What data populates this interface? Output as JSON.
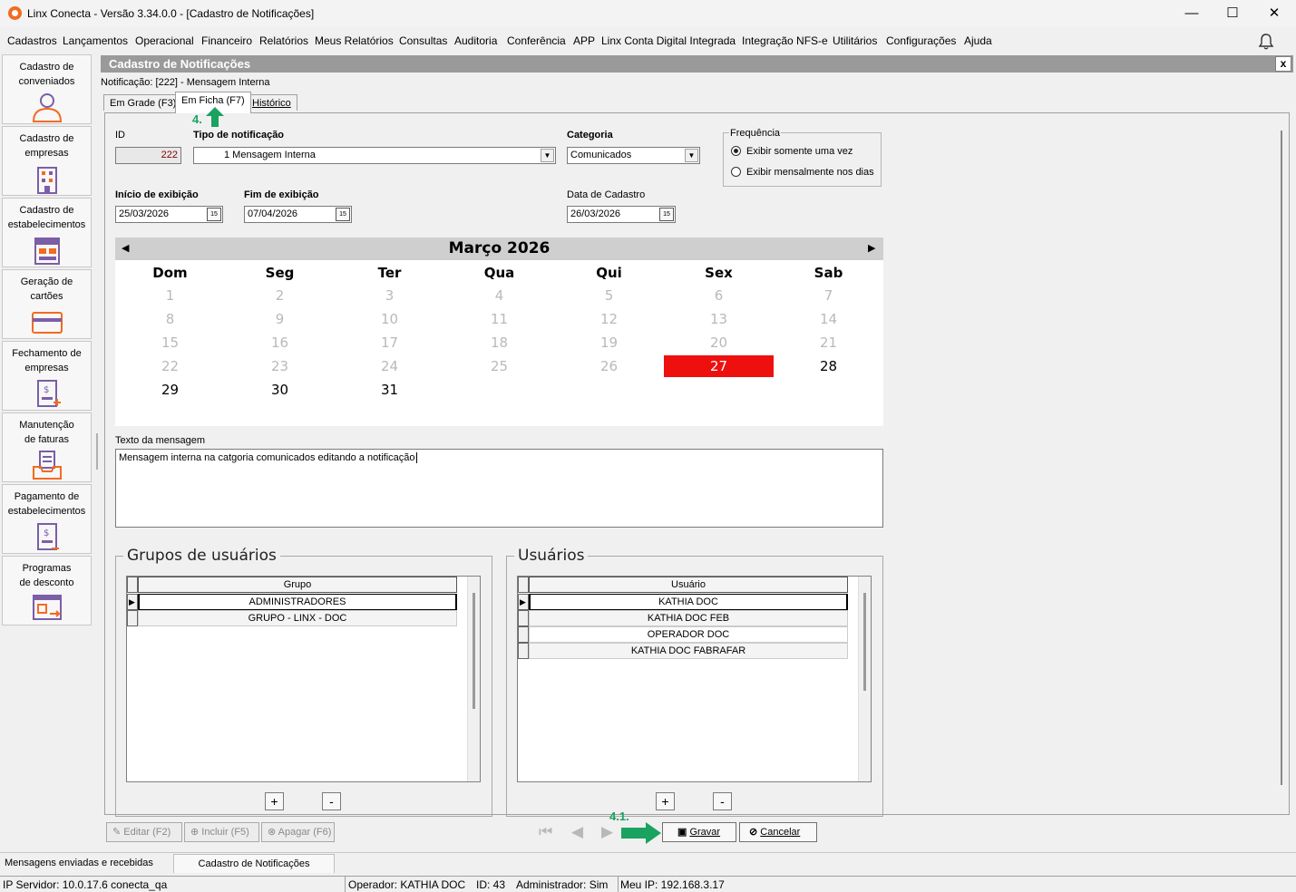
{
  "window": {
    "title": "Linx Conecta - Versão 3.34.0.0 - [Cadastro de Notificações]",
    "minimize": "—",
    "maximize": "☐",
    "close": "✕"
  },
  "menu": [
    "Cadastros",
    "Lançamentos",
    "Operacional",
    "Financeiro",
    "Relatórios",
    "Meus Relatórios",
    "Consultas",
    "Auditoria",
    "Conferência",
    "APP",
    "Linx Conta Digital Integrada",
    "Integração NFS-e",
    "Utilitários",
    "Configurações",
    "Ajuda"
  ],
  "sidebar": [
    {
      "label1": "Cadastro de",
      "label2": "conveniados",
      "icon": "user-icon"
    },
    {
      "label1": "Cadastro de",
      "label2": "empresas",
      "icon": "building-icon"
    },
    {
      "label1": "Cadastro de",
      "label2": "estabelecimentos",
      "icon": "store-icon"
    },
    {
      "label1": "Geração de",
      "label2": "cartões",
      "icon": "card-icon"
    },
    {
      "label1": "Fechamento de",
      "label2": "empresas",
      "icon": "invoice-icon"
    },
    {
      "label1": "Manutenção",
      "label2": "de faturas",
      "icon": "tray-icon"
    },
    {
      "label1": "Pagamento de",
      "label2": "estabelecimentos",
      "icon": "payment-icon"
    },
    {
      "label1": "Programas",
      "label2": "de desconto",
      "icon": "discount-icon"
    }
  ],
  "form": {
    "title": "Cadastro de Notificações",
    "close": "x",
    "notification_label": "Notificação: [222] - Mensagem Interna",
    "tabs": [
      "Em Grade (F3)",
      "Em Ficha (F7)",
      "Histórico"
    ],
    "step_tab": "4.",
    "step_save": "4.1."
  },
  "fields": {
    "id_label": "ID",
    "id_value": "222",
    "tipo_label": "Tipo de notificação",
    "tipo_value": "1  Mensagem Interna",
    "categoria_label": "Categoria",
    "categoria_value": "Comunicados",
    "freq_label": "Frequência",
    "freq_opt1": "Exibir somente uma vez",
    "freq_opt2": "Exibir mensalmente nos dias",
    "inicio_label": "Início de exibição",
    "inicio_value": "25/03/2026",
    "fim_label": "Fim de exibição",
    "fim_value": "07/04/2026",
    "cadastro_label": "Data de Cadastro",
    "cadastro_value": "26/03/2026",
    "cal_icon": "15"
  },
  "calendar": {
    "month": "Março 2026",
    "prev": "◀",
    "next": "▶",
    "weekdays": [
      "Dom",
      "Seg",
      "Ter",
      "Qua",
      "Qui",
      "Sex",
      "Sab"
    ],
    "selected_day": 27,
    "first_active_day": 27,
    "days_in_month": 31,
    "selected_color": "#ee0f0f"
  },
  "message": {
    "label": "Texto da mensagem",
    "value": "Mensagem interna na catgoria comunicados editando a notificação"
  },
  "groups": {
    "legend": "Grupos de usuários",
    "header": "Grupo",
    "rows": [
      "ADMINISTRADORES",
      "GRUPO - LINX - DOC"
    ],
    "add": "+",
    "remove": "-"
  },
  "users": {
    "legend": "Usuários",
    "header": "Usuário",
    "rows": [
      "KATHIA DOC",
      "KATHIA DOC FEB",
      "OPERADOR DOC",
      "KATHIA DOC FABRAFAR"
    ],
    "add": "+",
    "remove": "-"
  },
  "actions": {
    "edit": "Editar (F2)",
    "include": "Incluir (F5)",
    "delete": "Apagar (F6)",
    "save": "Gravar",
    "cancel": "Cancelar"
  },
  "statusbar": {
    "tab1": "Mensagens enviadas e recebidas",
    "tab2": "Cadastro de Notificações",
    "server": "IP Servidor: 10.0.17.6 conecta_qa",
    "operator": "Operador: KATHIA DOC",
    "id": "ID: 43",
    "admin": "Administrador: Sim",
    "ip": "Meu IP: 192.168.3.17"
  }
}
